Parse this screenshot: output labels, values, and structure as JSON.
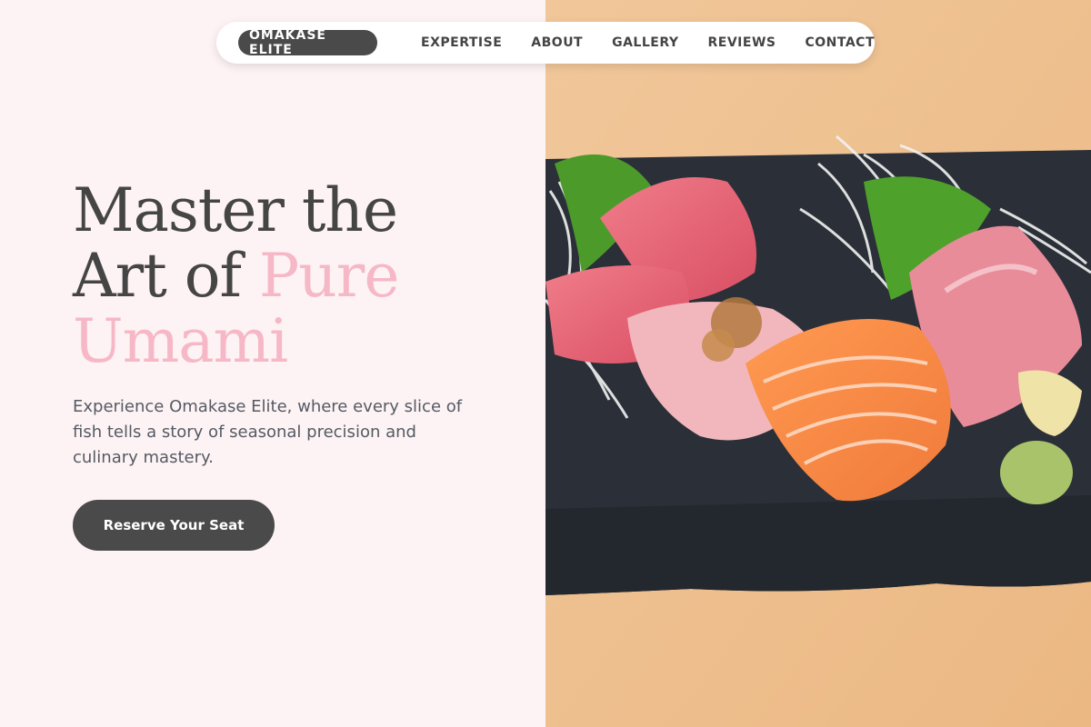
{
  "nav": {
    "brand": "OMAKASE ELITE",
    "links": [
      "EXPERTISE",
      "ABOUT",
      "GALLERY",
      "REVIEWS",
      "CONTACT"
    ]
  },
  "hero": {
    "line1": "Master the",
    "line2_a": "Art of ",
    "line2_b": "Pure",
    "line3": "Umami",
    "subtext": "Experience Omakase Elite, where every slice of fish tells a story of seasonal precision and culinary mastery.",
    "cta": "Reserve Your Seat"
  },
  "colors": {
    "background": "#fdf3f4",
    "accent_pink": "#f6b8c6",
    "dark": "#4a4a4a"
  }
}
